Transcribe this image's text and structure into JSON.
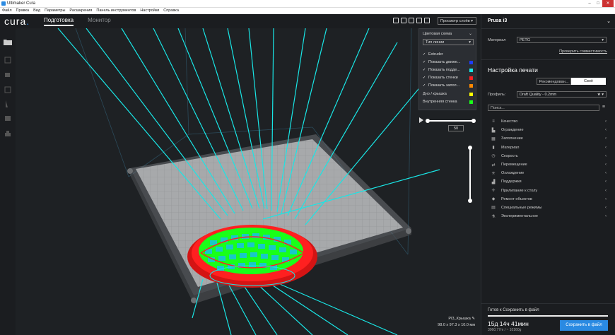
{
  "window": {
    "title": "Ultimaker Cura"
  },
  "menu": [
    "Файл",
    "Правка",
    "Вид",
    "Параметры",
    "Расширения",
    "Панель инструментов",
    "Настройки",
    "Справка"
  ],
  "header": {
    "logo": "cura",
    "tabs": [
      {
        "label": "Подготовка",
        "active": true
      },
      {
        "label": "Монитор",
        "active": false
      }
    ],
    "view_mode": "Просмотр слоёв"
  },
  "layer_view": {
    "color_scheme_label": "Цветовая схема",
    "color_scheme_value": "Тип линии",
    "extruder_label": "Extruder",
    "toggles": [
      {
        "label": "Показать движе...",
        "color": "#1e3cff"
      },
      {
        "label": "Показать подде...",
        "color": "#19e6e6"
      },
      {
        "label": "Показать стенки",
        "color": "#ff2020"
      },
      {
        "label": "Показать запол...",
        "color": "#ff8a00"
      }
    ],
    "extra": [
      {
        "label": "Дно / крышка",
        "color": "#ffff00"
      },
      {
        "label": "Внутренняя стенка",
        "color": "#19ff19"
      }
    ],
    "current_layer": "50"
  },
  "object": {
    "name": "PI3_Крышка",
    "dimensions": "98.0 x 97.3 x 10.0 мм"
  },
  "sidebar": {
    "printer": "Prusa i3",
    "material_label": "Материал",
    "material_value": "PETG",
    "compat_link": "Проверить совместимость",
    "heading": "Настройка печати",
    "mode_recommended": "Рекомендован...",
    "mode_custom": "Своё",
    "profile_label": "Профиль:",
    "profile_value": "Draft Quality - 0.2mm",
    "search_placeholder": "Поиск...",
    "categories": [
      {
        "label": "Качество",
        "icon": "quality-icon"
      },
      {
        "label": "Ограждение",
        "icon": "shell-icon"
      },
      {
        "label": "Заполнение",
        "icon": "infill-icon"
      },
      {
        "label": "Материал",
        "icon": "material-icon"
      },
      {
        "label": "Скорость",
        "icon": "speed-icon"
      },
      {
        "label": "Перемещение",
        "icon": "travel-icon"
      },
      {
        "label": "Охлаждение",
        "icon": "cooling-icon"
      },
      {
        "label": "Поддержки",
        "icon": "support-icon"
      },
      {
        "label": "Прилипание к столу",
        "icon": "adhesion-icon"
      },
      {
        "label": "Ремонт объектов",
        "icon": "mesh-fix-icon"
      },
      {
        "label": "Специальные режимы",
        "icon": "special-modes-icon"
      },
      {
        "label": "Экспериментальное",
        "icon": "experimental-icon"
      }
    ],
    "status": "Готов к Сохранить в файл",
    "progress": 1.0,
    "print_time": "15д 14ч 41мин",
    "usage": "3060.77m / ~ 10160g",
    "save_button": "Сохранить в файл"
  },
  "colors": {
    "accent": "#2a8ae2",
    "support": "#19e6e6",
    "wall": "#ff2020",
    "inner_wall": "#19ff19"
  }
}
